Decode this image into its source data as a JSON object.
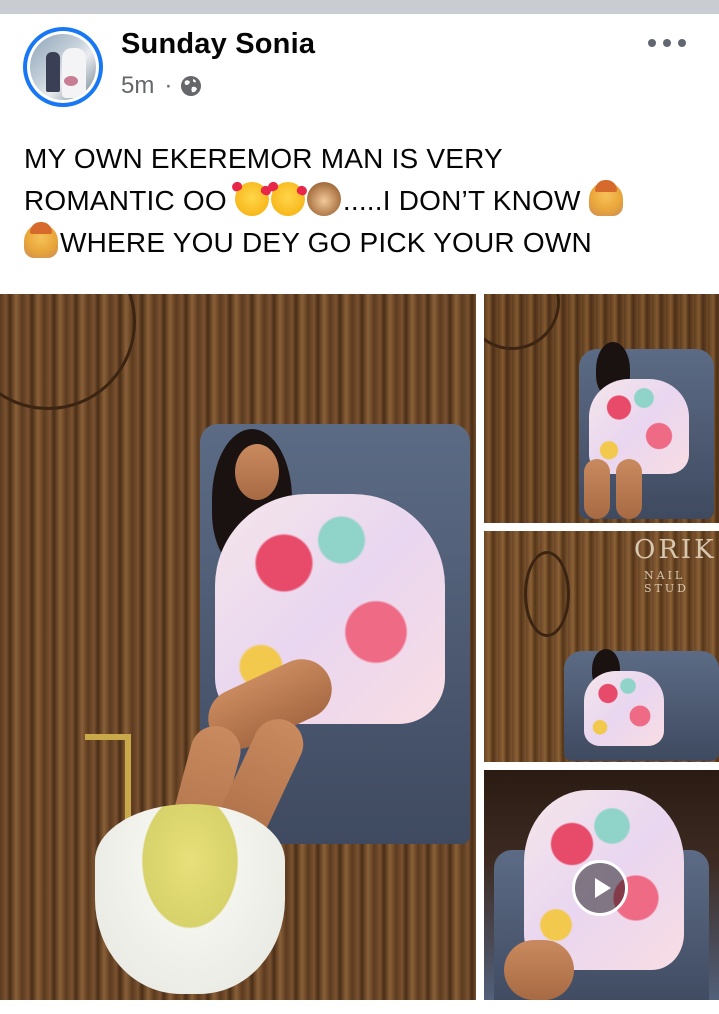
{
  "post": {
    "author": "Sunday Sonia",
    "time": "5m",
    "separator": "·",
    "audience_icon": "globe-icon",
    "menu_icon": "more-options-icon",
    "text_lines": [
      "MY OWN EKEREMOR MAN  IS VERY",
      "ROMANTIC OO",
      ".....I DON’T KNOW",
      "WHERE YOU DEY GO PICK YOUR OWN"
    ],
    "emojis": [
      "smiling-face-with-hearts",
      "smiling-face-with-hearts",
      "see-no-evil-monkey",
      "person-raising-hand",
      "person-raising-hand"
    ],
    "photos": {
      "count_visible": 4,
      "last_is_video": true,
      "sign_brand": "ORIK",
      "sign_subtitle": "NAIL STUD"
    },
    "colors": {
      "author": "#050505",
      "meta": "#65676b",
      "avatar_ring": "#1877f2"
    }
  }
}
